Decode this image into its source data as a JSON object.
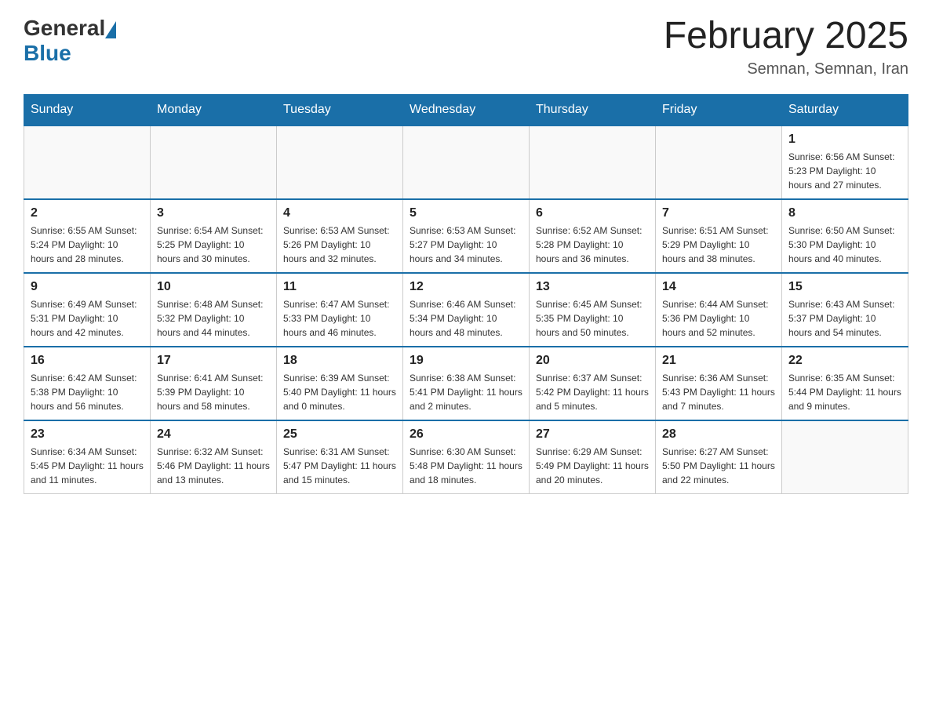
{
  "logo": {
    "general": "General",
    "blue": "Blue"
  },
  "title": "February 2025",
  "location": "Semnan, Semnan, Iran",
  "days_of_week": [
    "Sunday",
    "Monday",
    "Tuesday",
    "Wednesday",
    "Thursday",
    "Friday",
    "Saturday"
  ],
  "weeks": [
    [
      {
        "day": "",
        "info": ""
      },
      {
        "day": "",
        "info": ""
      },
      {
        "day": "",
        "info": ""
      },
      {
        "day": "",
        "info": ""
      },
      {
        "day": "",
        "info": ""
      },
      {
        "day": "",
        "info": ""
      },
      {
        "day": "1",
        "info": "Sunrise: 6:56 AM\nSunset: 5:23 PM\nDaylight: 10 hours and 27 minutes."
      }
    ],
    [
      {
        "day": "2",
        "info": "Sunrise: 6:55 AM\nSunset: 5:24 PM\nDaylight: 10 hours and 28 minutes."
      },
      {
        "day": "3",
        "info": "Sunrise: 6:54 AM\nSunset: 5:25 PM\nDaylight: 10 hours and 30 minutes."
      },
      {
        "day": "4",
        "info": "Sunrise: 6:53 AM\nSunset: 5:26 PM\nDaylight: 10 hours and 32 minutes."
      },
      {
        "day": "5",
        "info": "Sunrise: 6:53 AM\nSunset: 5:27 PM\nDaylight: 10 hours and 34 minutes."
      },
      {
        "day": "6",
        "info": "Sunrise: 6:52 AM\nSunset: 5:28 PM\nDaylight: 10 hours and 36 minutes."
      },
      {
        "day": "7",
        "info": "Sunrise: 6:51 AM\nSunset: 5:29 PM\nDaylight: 10 hours and 38 minutes."
      },
      {
        "day": "8",
        "info": "Sunrise: 6:50 AM\nSunset: 5:30 PM\nDaylight: 10 hours and 40 minutes."
      }
    ],
    [
      {
        "day": "9",
        "info": "Sunrise: 6:49 AM\nSunset: 5:31 PM\nDaylight: 10 hours and 42 minutes."
      },
      {
        "day": "10",
        "info": "Sunrise: 6:48 AM\nSunset: 5:32 PM\nDaylight: 10 hours and 44 minutes."
      },
      {
        "day": "11",
        "info": "Sunrise: 6:47 AM\nSunset: 5:33 PM\nDaylight: 10 hours and 46 minutes."
      },
      {
        "day": "12",
        "info": "Sunrise: 6:46 AM\nSunset: 5:34 PM\nDaylight: 10 hours and 48 minutes."
      },
      {
        "day": "13",
        "info": "Sunrise: 6:45 AM\nSunset: 5:35 PM\nDaylight: 10 hours and 50 minutes."
      },
      {
        "day": "14",
        "info": "Sunrise: 6:44 AM\nSunset: 5:36 PM\nDaylight: 10 hours and 52 minutes."
      },
      {
        "day": "15",
        "info": "Sunrise: 6:43 AM\nSunset: 5:37 PM\nDaylight: 10 hours and 54 minutes."
      }
    ],
    [
      {
        "day": "16",
        "info": "Sunrise: 6:42 AM\nSunset: 5:38 PM\nDaylight: 10 hours and 56 minutes."
      },
      {
        "day": "17",
        "info": "Sunrise: 6:41 AM\nSunset: 5:39 PM\nDaylight: 10 hours and 58 minutes."
      },
      {
        "day": "18",
        "info": "Sunrise: 6:39 AM\nSunset: 5:40 PM\nDaylight: 11 hours and 0 minutes."
      },
      {
        "day": "19",
        "info": "Sunrise: 6:38 AM\nSunset: 5:41 PM\nDaylight: 11 hours and 2 minutes."
      },
      {
        "day": "20",
        "info": "Sunrise: 6:37 AM\nSunset: 5:42 PM\nDaylight: 11 hours and 5 minutes."
      },
      {
        "day": "21",
        "info": "Sunrise: 6:36 AM\nSunset: 5:43 PM\nDaylight: 11 hours and 7 minutes."
      },
      {
        "day": "22",
        "info": "Sunrise: 6:35 AM\nSunset: 5:44 PM\nDaylight: 11 hours and 9 minutes."
      }
    ],
    [
      {
        "day": "23",
        "info": "Sunrise: 6:34 AM\nSunset: 5:45 PM\nDaylight: 11 hours and 11 minutes."
      },
      {
        "day": "24",
        "info": "Sunrise: 6:32 AM\nSunset: 5:46 PM\nDaylight: 11 hours and 13 minutes."
      },
      {
        "day": "25",
        "info": "Sunrise: 6:31 AM\nSunset: 5:47 PM\nDaylight: 11 hours and 15 minutes."
      },
      {
        "day": "26",
        "info": "Sunrise: 6:30 AM\nSunset: 5:48 PM\nDaylight: 11 hours and 18 minutes."
      },
      {
        "day": "27",
        "info": "Sunrise: 6:29 AM\nSunset: 5:49 PM\nDaylight: 11 hours and 20 minutes."
      },
      {
        "day": "28",
        "info": "Sunrise: 6:27 AM\nSunset: 5:50 PM\nDaylight: 11 hours and 22 minutes."
      },
      {
        "day": "",
        "info": ""
      }
    ]
  ]
}
